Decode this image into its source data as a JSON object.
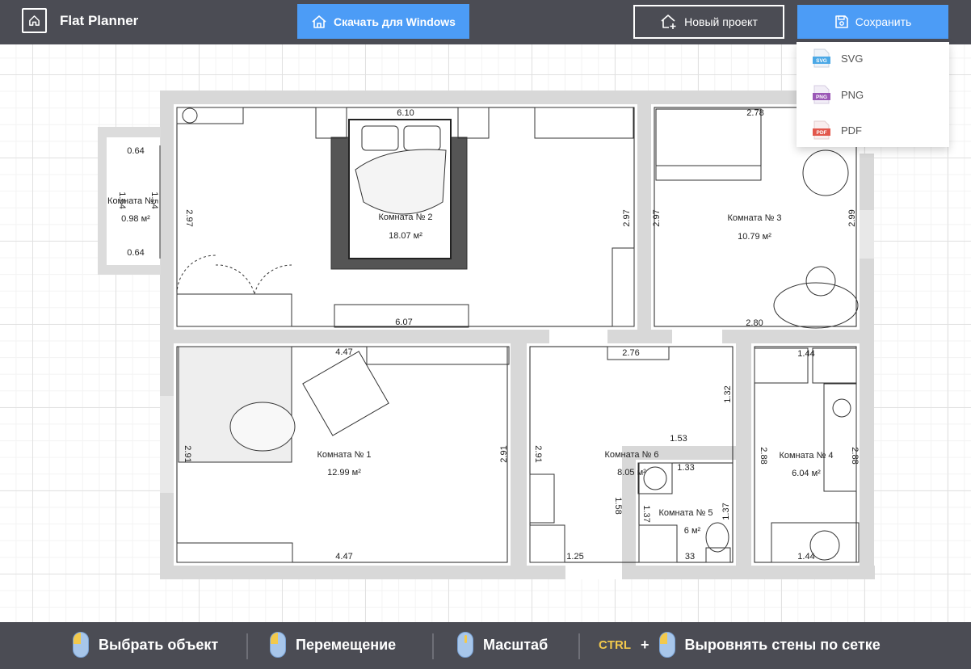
{
  "app": {
    "title": "Flat Planner"
  },
  "toolbar": {
    "download_label": "Скачать для Windows",
    "new_project_label": "Новый проект",
    "save_label": "Сохранить"
  },
  "save_menu": {
    "items": [
      {
        "label": "SVG",
        "badge": "SVG",
        "color": "#4aa8e6"
      },
      {
        "label": "PNG",
        "badge": "PNG",
        "color": "#9b59b6"
      },
      {
        "label": "PDF",
        "badge": "PDF",
        "color": "#e2574c"
      }
    ]
  },
  "floorplan": {
    "rooms": [
      {
        "name": "Комната №",
        "area": "0.98 м²"
      },
      {
        "name": "Комната № 2",
        "area": "18.07 м²"
      },
      {
        "name": "Комната № 3",
        "area": "10.79 м²"
      },
      {
        "name": "Комната № 1",
        "area": "12.99 м²"
      },
      {
        "name": "Комната № 6",
        "area": "8.05 м²"
      },
      {
        "name": "Комната № 5",
        "area": "6 м²"
      },
      {
        "name": "Комната № 4",
        "area": "6.04 м²"
      }
    ],
    "dimensions": [
      "6.10",
      "2.78",
      "0.64",
      "1.54",
      "1.54",
      "0.64",
      "2.97",
      "2.97",
      "2.97",
      "2.99",
      "6.07",
      "2.80",
      "4.47",
      "2.76",
      "1.44",
      "1.32",
      "2.91",
      "2.91",
      "2.91",
      "1.53",
      "1.33",
      "2.88",
      "2.88",
      "1.58",
      "1.37",
      "1.37",
      "4.47",
      "1.25",
      "33",
      "1.44"
    ]
  },
  "hints": {
    "select": "Выбрать объект",
    "move": "Перемещение",
    "zoom": "Масштаб",
    "ctrl": "CTRL",
    "plus": "+",
    "snap": "Выровнять стены по сетке"
  }
}
